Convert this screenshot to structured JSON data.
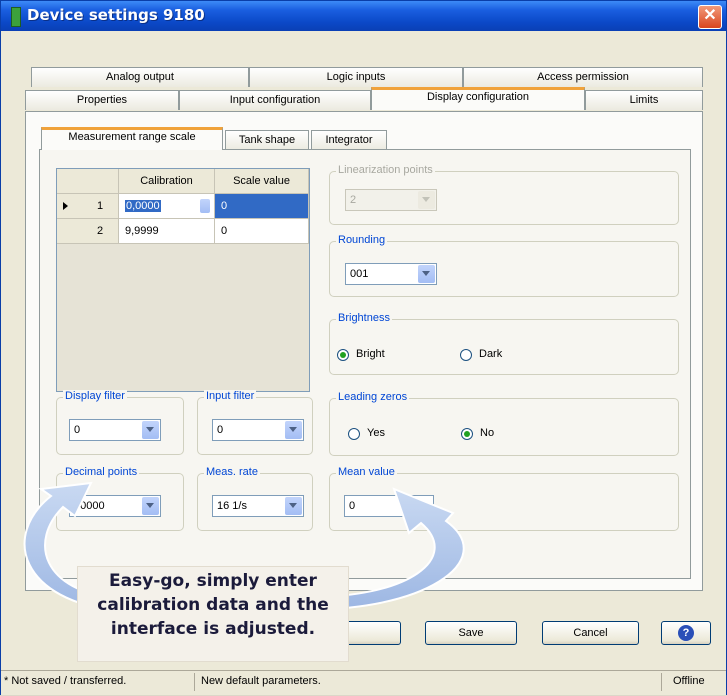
{
  "window": {
    "title": "Device settings 9180",
    "close_glyph": "✕"
  },
  "tabs_row1": [
    "Analog output",
    "Logic inputs",
    "Access permission"
  ],
  "tabs_row2": [
    "Properties",
    "Input configuration",
    "Display configuration",
    "Limits"
  ],
  "active_tab": "Display configuration",
  "subtabs": [
    "Measurement range scale",
    "Tank shape",
    "Integrator"
  ],
  "active_subtab": "Measurement range scale",
  "table": {
    "columns": [
      "Calibration",
      "Scale value"
    ],
    "rows": [
      {
        "index": "1",
        "calibration": "0,0000",
        "scale": "0"
      },
      {
        "index": "2",
        "calibration": "9,9999",
        "scale": "0"
      }
    ]
  },
  "linearization": {
    "label": "Linearization points",
    "value": "2"
  },
  "rounding": {
    "label": "Rounding",
    "value": "001"
  },
  "brightness": {
    "label": "Brightness",
    "options": [
      "Bright",
      "Dark"
    ],
    "selected": "Bright"
  },
  "display_filter": {
    "label": "Display filter",
    "value": "0"
  },
  "input_filter": {
    "label": "Input filter",
    "value": "0"
  },
  "leading_zeros": {
    "label": "Leading zeros",
    "options": [
      "Yes",
      "No"
    ],
    "selected": "No"
  },
  "decimal_points": {
    "label": "Decimal points",
    "value": "00000"
  },
  "meas_rate": {
    "label": "Meas. rate",
    "value": "16 1/s"
  },
  "mean_value": {
    "label": "Mean value",
    "value": "0"
  },
  "buttons": {
    "save": "Save",
    "cancel": "Cancel",
    "help_glyph": "?"
  },
  "callout": {
    "line1": "Easy-go, simply enter",
    "line2": "calibration data and the",
    "line3": "interface is adjusted."
  },
  "status": {
    "left": "* Not saved / transferred.",
    "middle": "New default parameters.",
    "right": "Offline"
  },
  "colors": {
    "titlebar": "#0b49c8",
    "accent_tab": "#f0a23a",
    "group_label": "#0046d5",
    "selection": "#316ac5"
  }
}
